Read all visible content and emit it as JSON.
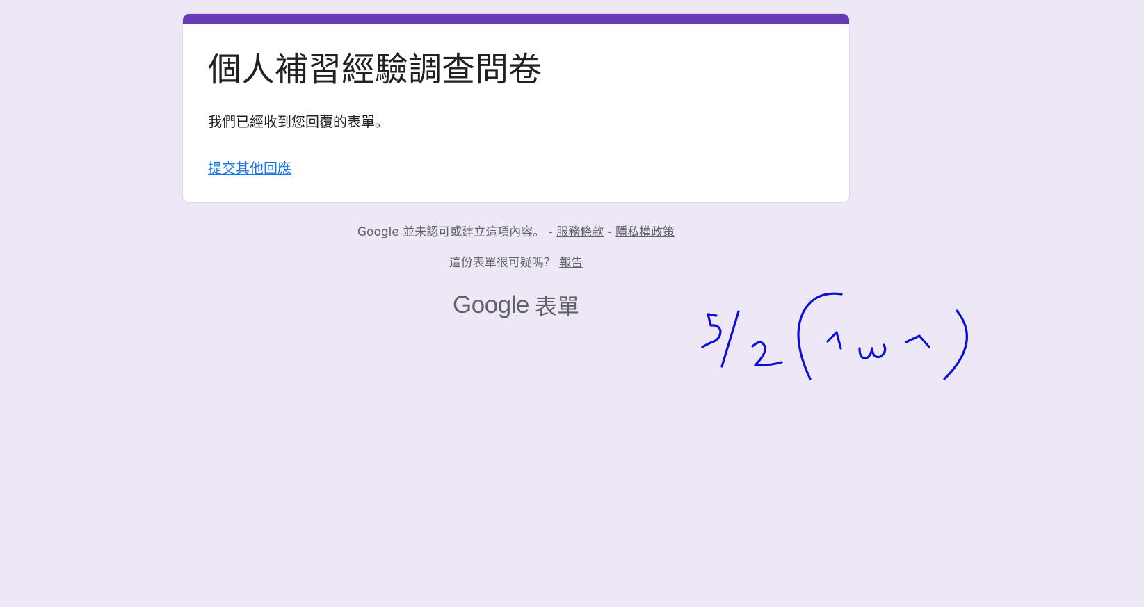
{
  "colors": {
    "page_background": "#ede7f6",
    "accent": "#673ab7",
    "link": "#1a73e8",
    "text": "#202124",
    "muted_text": "#5f6368",
    "handwriting_ink": "#0a10d8"
  },
  "card": {
    "title": "個人補習經驗調查問卷",
    "message": "我們已經收到您回覆的表單。",
    "submit_another_link": "提交其他回應"
  },
  "footer": {
    "disclaimer": "Google 並未認可或建立這項內容。 - ",
    "terms_link": "服務條款",
    "separator": " - ",
    "privacy_link": "隱私權政策",
    "suspicious_text": "這份表單很可疑嗎？ ",
    "report_link": "報告"
  },
  "branding": {
    "google_text": "Google",
    "product_text": "表單"
  },
  "annotation": {
    "handwritten_text": "5/2(ˉωˉ)"
  }
}
